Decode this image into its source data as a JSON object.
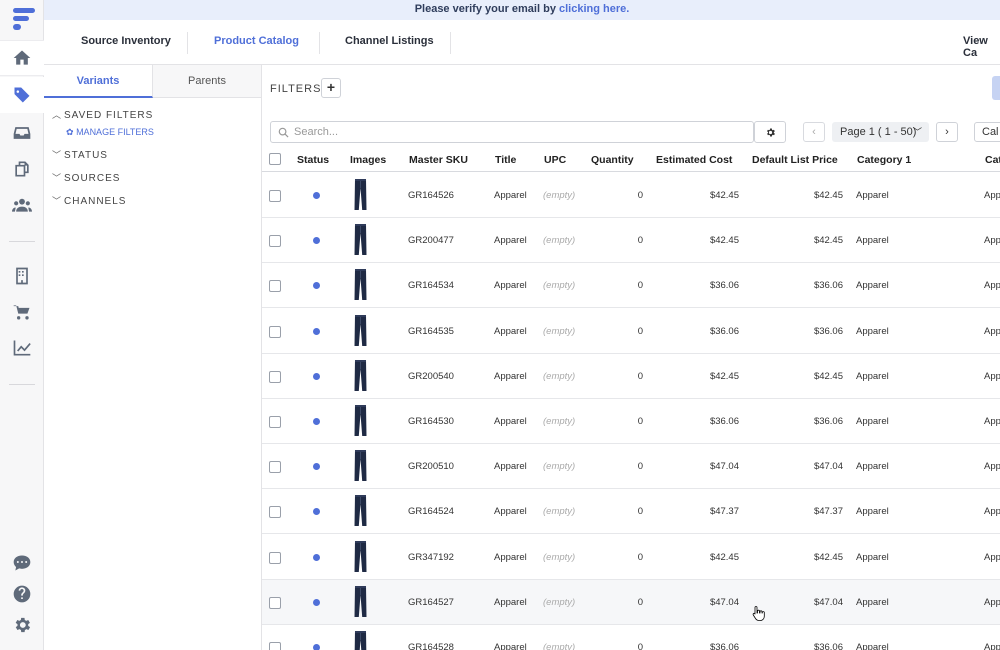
{
  "banner": {
    "text": "Please verify your email by",
    "link": "clicking here."
  },
  "nav": {
    "tabs": [
      "Source Inventory",
      "Product Catalog",
      "Channel Listings"
    ],
    "right": "View Ca"
  },
  "sidebar": {
    "tabs": [
      "Variants",
      "Parents"
    ],
    "groups": [
      "SAVED FILTERS",
      "STATUS",
      "SOURCES",
      "CHANNELS"
    ],
    "manage": "MANAGE FILTERS"
  },
  "toolbar": {
    "filters_label": "FILTERS",
    "add": "+",
    "search_placeholder": "Search...",
    "page_select": "Page 1 ( 1 - 50)",
    "prev": "‹",
    "next": "›",
    "cal": "Cal"
  },
  "table": {
    "headers": [
      "Status",
      "Images",
      "Master SKU",
      "Title",
      "UPC",
      "Quantity",
      "Estimated Cost",
      "Default List Price",
      "Category 1",
      "Cat"
    ],
    "rows": [
      {
        "sku": "GR164526",
        "title": "Apparel",
        "upc": "(empty)",
        "qty": "0",
        "cost": "$42.45",
        "price": "$42.45",
        "cat": "Apparel",
        "cat2": "App"
      },
      {
        "sku": "GR200477",
        "title": "Apparel",
        "upc": "(empty)",
        "qty": "0",
        "cost": "$42.45",
        "price": "$42.45",
        "cat": "Apparel",
        "cat2": "App"
      },
      {
        "sku": "GR164534",
        "title": "Apparel",
        "upc": "(empty)",
        "qty": "0",
        "cost": "$36.06",
        "price": "$36.06",
        "cat": "Apparel",
        "cat2": "App"
      },
      {
        "sku": "GR164535",
        "title": "Apparel",
        "upc": "(empty)",
        "qty": "0",
        "cost": "$36.06",
        "price": "$36.06",
        "cat": "Apparel",
        "cat2": "App"
      },
      {
        "sku": "GR200540",
        "title": "Apparel",
        "upc": "(empty)",
        "qty": "0",
        "cost": "$42.45",
        "price": "$42.45",
        "cat": "Apparel",
        "cat2": "App"
      },
      {
        "sku": "GR164530",
        "title": "Apparel",
        "upc": "(empty)",
        "qty": "0",
        "cost": "$36.06",
        "price": "$36.06",
        "cat": "Apparel",
        "cat2": "App"
      },
      {
        "sku": "GR200510",
        "title": "Apparel",
        "upc": "(empty)",
        "qty": "0",
        "cost": "$47.04",
        "price": "$47.04",
        "cat": "Apparel",
        "cat2": "App"
      },
      {
        "sku": "GR164524",
        "title": "Apparel",
        "upc": "(empty)",
        "qty": "0",
        "cost": "$47.37",
        "price": "$47.37",
        "cat": "Apparel",
        "cat2": "App"
      },
      {
        "sku": "GR347192",
        "title": "Apparel",
        "upc": "(empty)",
        "qty": "0",
        "cost": "$42.45",
        "price": "$42.45",
        "cat": "Apparel",
        "cat2": "App"
      },
      {
        "sku": "GR164527",
        "title": "Apparel",
        "upc": "(empty)",
        "qty": "0",
        "cost": "$47.04",
        "price": "$47.04",
        "cat": "Apparel",
        "cat2": "App"
      },
      {
        "sku": "GR164528",
        "title": "Apparel",
        "upc": "(empty)",
        "qty": "0",
        "cost": "$36.06",
        "price": "$36.06",
        "cat": "Apparel",
        "cat2": "App"
      }
    ]
  },
  "colors": {
    "accent": "#4f6fd8",
    "banner_bg": "#e8eefb",
    "rail_bg": "#f7f7f8"
  }
}
